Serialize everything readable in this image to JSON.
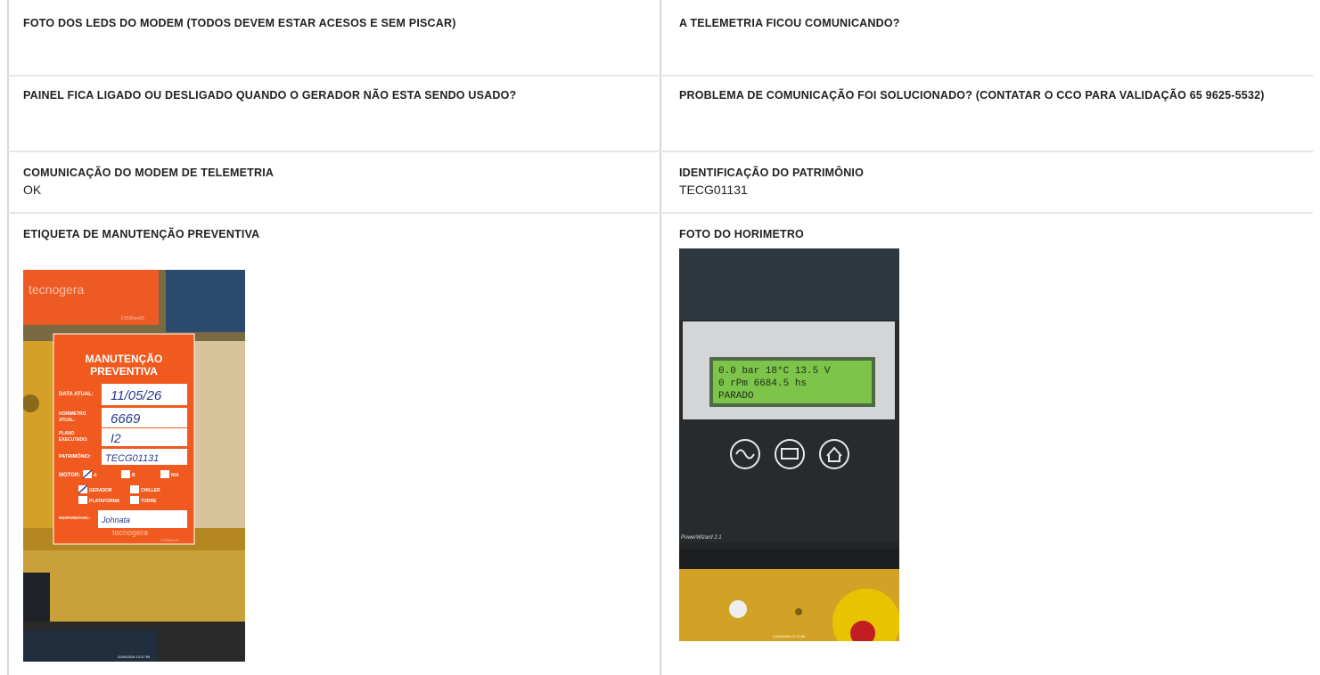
{
  "rows": [
    {
      "left": {
        "label": "FOTO DOS LEDS DO MODEM (TODOS DEVEM ESTAR ACESOS E SEM PISCAR)",
        "value": ""
      },
      "right": {
        "label": "A TELEMETRIA FICOU COMUNICANDO?",
        "value": ""
      }
    },
    {
      "left": {
        "label": "PAINEL FICA LIGADO OU DESLIGADO QUANDO O GERADOR NÃO ESTA SENDO USADO?",
        "value": ""
      },
      "right": {
        "label": "PROBLEMA DE COMUNICAÇÃO FOI SOLUCIONADO? (CONTATAR O CCO PARA VALIDAÇÃO 65 9625-5532)",
        "value": ""
      }
    },
    {
      "left": {
        "label": "COMUNICAÇÃO DO MODEM DE TELEMETRIA",
        "value": "OK"
      },
      "right": {
        "label": "IDENTIFICAÇÃO DO PATRIMÔNIO",
        "value": "TECG01131"
      }
    },
    {
      "left": {
        "label": "ETIQUETA DE MANUTENÇÃO PREVENTIVA",
        "value": ""
      },
      "right": {
        "label": "FOTO DO HORIMETRO",
        "value": ""
      }
    }
  ],
  "photos": {
    "etiqueta": {
      "brand": "tecnogera",
      "form_code": "F259Rev00",
      "title_line1": "MANUTENÇÃO",
      "title_line2": "PREVENTIVA",
      "data_atual_label": "DATA ATUAL:",
      "data_atual_value": "11/05/26",
      "horimetro_label1": "HORIMETRO",
      "horimetro_label2": "ATUAL:",
      "horimetro_value": "6669",
      "plano_label1": "PLANO",
      "plano_label2": "EXECUTADO:",
      "plano_value": "I2",
      "patrimonio_label": "PATRIMÔNIO:",
      "patrimonio_value": "TECG01131",
      "motor_label": "MOTOR:",
      "motor_a": "A",
      "motor_b": "B",
      "motor_na": "N/A",
      "gerador": "GERADOR",
      "chiller": "CHILLER",
      "plataforma": "PLATAFORMA",
      "torre": "TORRE",
      "responsavel_label": "RESPONSÁVEL:",
      "responsavel_value": "Johnata",
      "timestamp": "11/05/2026 12:27:59"
    },
    "horimetro": {
      "lcd_line1": "0.0 bar     18°C  13.5 V",
      "lcd_line2": "0 rPm     6684.5 hs",
      "lcd_line3": "PARADO",
      "panel_brand": "PowerWizard 2.1",
      "timestamp": "11/05/2026 12:12:50"
    }
  },
  "colors": {
    "label_orange": "#f05a1e",
    "machine_yellow": "#d9a520",
    "lcd_green": "#6cc23a",
    "panel_dark": "#2a2d30"
  }
}
